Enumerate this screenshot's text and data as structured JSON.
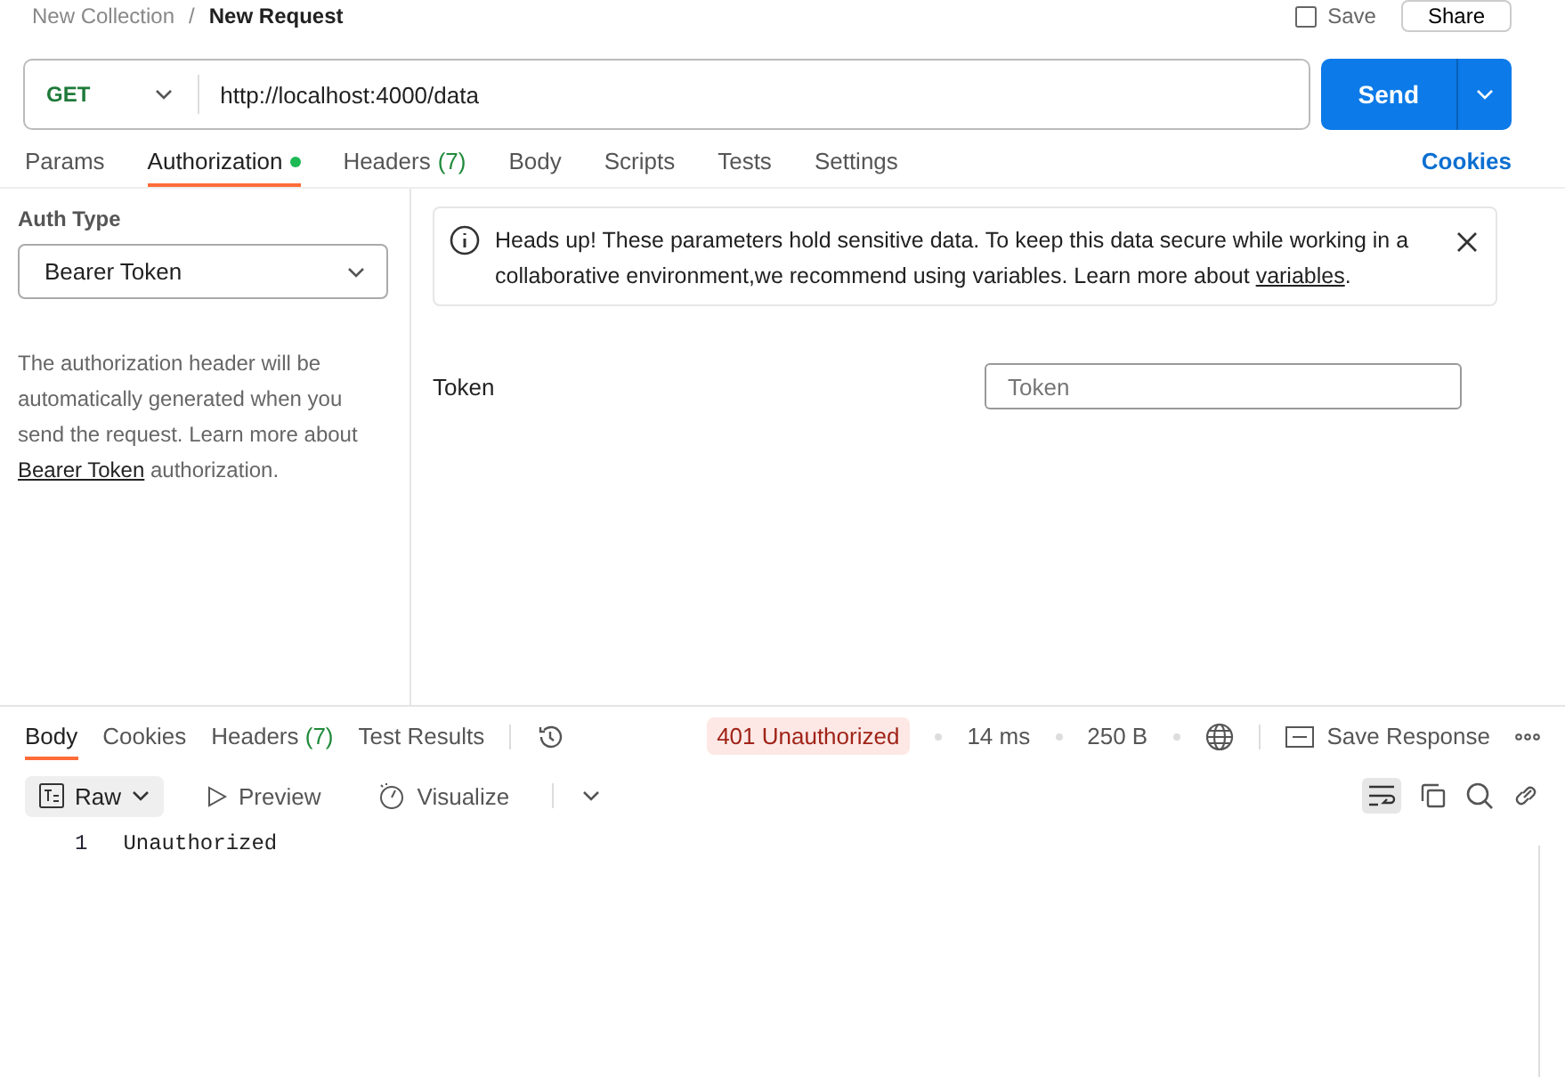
{
  "header": {
    "breadcrumb": [
      "New Collection",
      "New Request"
    ],
    "separator": "/",
    "save": "Save",
    "share": "Share"
  },
  "request": {
    "method": "GET",
    "url": "http://localhost:4000/data",
    "send": "Send"
  },
  "tabs": [
    {
      "label": "Params",
      "selected": false,
      "dot": false
    },
    {
      "label": "Authorization",
      "selected": true,
      "dot": true
    },
    {
      "label": "Headers",
      "count": "(7)",
      "selected": false,
      "dot": false
    },
    {
      "label": "Body",
      "selected": false,
      "dot": false
    },
    {
      "label": "Scripts",
      "selected": false,
      "dot": false
    },
    {
      "label": "Tests",
      "selected": false,
      "dot": false
    },
    {
      "label": "Settings",
      "selected": false,
      "dot": false
    }
  ],
  "cookies_link": "Cookies",
  "auth": {
    "label": "Auth Type",
    "type": "Bearer Token",
    "description": "The authorization header will be automatically generated when you send the request. Learn more about ",
    "link": "Bearer Token",
    "after": " authorization."
  },
  "notice": {
    "text": "Heads up! These parameters hold sensitive data. To keep this data secure while working in a collaborative environment,we recommend using variables. Learn more about ",
    "link": "variables",
    "after": "."
  },
  "token": {
    "label": "Token",
    "placeholder": "Token"
  },
  "response_tabs": [
    {
      "label": "Body",
      "selected": true
    },
    {
      "label": "Cookies",
      "selected": false
    },
    {
      "label": "Headers",
      "count": "(7)",
      "selected": false
    },
    {
      "label": "Test Results",
      "selected": false
    }
  ],
  "status": {
    "code": "401 Unauthorized",
    "time": "14 ms",
    "size": "250 B",
    "save": "Save Response"
  },
  "views": [
    {
      "label": "Raw",
      "selected": true
    },
    {
      "label": "Preview",
      "selected": false
    },
    {
      "label": "Visualize",
      "selected": false
    }
  ],
  "wrap": {
    "on": true
  },
  "lines": [
    {
      "number": "1",
      "text": "Unauthorized"
    }
  ]
}
